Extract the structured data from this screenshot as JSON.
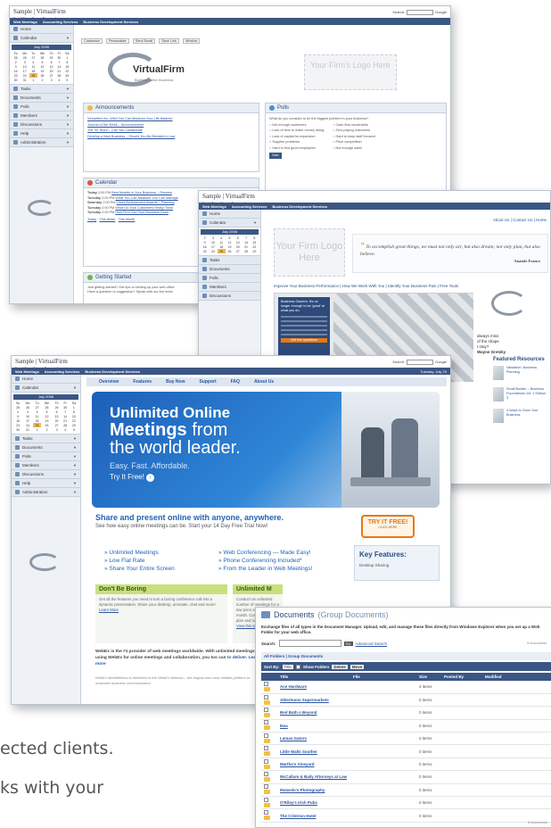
{
  "brand": {
    "title": "Sample | VirtualFirm",
    "subtitle": "Email Now | Forgot Password"
  },
  "search": {
    "label": "Search:",
    "engine": "Google"
  },
  "nav": {
    "items": [
      "Web Meetings",
      "Accounting Services",
      "Business Development Services"
    ]
  },
  "sidebar": {
    "items": [
      {
        "label": "Home",
        "icon": "home-icon"
      },
      {
        "label": "Calendar",
        "icon": "calendar-icon"
      },
      {
        "label": "Tasks",
        "icon": "tasks-icon"
      },
      {
        "label": "Documents",
        "icon": "documents-icon"
      },
      {
        "label": "Polls",
        "icon": "polls-icon"
      },
      {
        "label": "Members",
        "icon": "members-icon"
      },
      {
        "label": "Discussions",
        "icon": "discussions-icon"
      },
      {
        "label": "Help",
        "icon": "help-icon"
      },
      {
        "label": "Administration",
        "icon": "admin-icon"
      }
    ],
    "calendar": {
      "month": "July 2006",
      "days": [
        "Su",
        "Mo",
        "Tu",
        "We",
        "Th",
        "Fr",
        "Sa"
      ],
      "weeks": [
        [
          "25",
          "26",
          "27",
          "28",
          "29",
          "30",
          "1"
        ],
        [
          "2",
          "3",
          "4",
          "5",
          "6",
          "7",
          "8"
        ],
        [
          "9",
          "10",
          "11",
          "12",
          "13",
          "14",
          "15"
        ],
        [
          "16",
          "17",
          "18",
          "19",
          "20",
          "21",
          "22"
        ],
        [
          "23",
          "24",
          "25",
          "26",
          "27",
          "28",
          "29"
        ],
        [
          "30",
          "31",
          "1",
          "2",
          "3",
          "4",
          "5"
        ]
      ]
    }
  },
  "win1": {
    "toolbar": [
      "Customize",
      "Personalize",
      "Send Email",
      "Save Link",
      "Window"
    ],
    "logo_text": "VirtualFirm",
    "logo_tagline": "Building Better Business",
    "placeholder": "Your Firm's Logo Here",
    "announcements": {
      "title": "Announcements",
      "items": [
        "Virtualfirm Inc. Wish You Can Measure Your Life Balance",
        "Journal of the Week – Announcement",
        "The 'W' Word – Can You Collaborate",
        "Develop a New Business – Should You Be Blended in Law"
      ]
    },
    "polls": {
      "title": "Polls",
      "question": "What do you consider to be the biggest problem in your business?",
      "options_left": [
        "Not enough customers",
        "Lack of time to make money doing",
        "Lack of capital for expansion",
        "Supplier problems",
        "Hard to find good employees"
      ],
      "options_right": [
        "Cash flow constraints",
        "Zero paying customers",
        "Hard to keep staff focused",
        "Price competition",
        "Not enough sales"
      ],
      "vote": "Vote"
    },
    "calendar": {
      "title": "Calendar",
      "rows": [
        {
          "day": "Today",
          "time": "2:00 PM",
          "event": "Best Models in Your Business – Preview"
        },
        {
          "day": "Tuesday",
          "time": "2:00 PM",
          "event": "What You Can Measure You Can Manage"
        },
        {
          "day": "Saturday",
          "time": "2:00 PM",
          "event": "Client Achievement Awards – Planning"
        },
        {
          "day": "Tuesday",
          "time": "2:00 PM",
          "event": "What Do Your Customers Really Think"
        },
        {
          "day": "Tuesday",
          "time": "2:00 PM",
          "event": "How Firm Can Your Business Grow"
        }
      ],
      "footer": [
        "Today",
        "This Week",
        "This Month"
      ]
    },
    "getting_started": {
      "title": "Getting Started",
      "items": [
        "Just getting started? Get tips on setting up your web office",
        "Have a question or suggestion? Speak with our live team"
      ]
    }
  },
  "win2": {
    "top_links": "About Us | Contact Us | Home",
    "logo": "Your Firm Logo Here",
    "quote": "To accomplish great things, we must not only act, but also dream; not only plan, but also believe.",
    "quote_author": "Anatole France",
    "subnav": "Improve Your Business Performance | How We Work With You | Identify Your Business Pain | Free Tools",
    "body_title": "Business Owners: It's no longer enough to be 'good' at what you do.",
    "cta": "Get the questions",
    "side_snip": [
      "always miss",
      "of the shape",
      "t stay?",
      "Wayne Gretzky"
    ],
    "featured_title": "Featured Resources",
    "featured": [
      "Validation: Business Planning",
      "Small Builder – Business Foundations Vol. 1 Edition 3",
      "4 Ways to Grow Your Business"
    ],
    "more": "more"
  },
  "win3": {
    "tabs": [
      "Overview",
      "Features",
      "Buy Now",
      "Support",
      "FAQ",
      "About Us"
    ],
    "date": "Tuesday, July 25",
    "banner": {
      "line1": "Unlimited Online",
      "line2": "Meetings",
      "line2b": "from",
      "line3": "the world leader.",
      "line4": "Easy. Fast. Affordable.",
      "line5": "Try It Free!"
    },
    "headline": "Share and present online with anyone, anywhere.",
    "subhead": "See how easy online meetings can be. Start your 14 Day Free Trial Now!",
    "try_btn": "TRY IT FREE!",
    "try_sub": "CLICK HERE",
    "features_left": [
      "Unlimited Meetings",
      "Low Flat Rate",
      "Share Your Entire Screen"
    ],
    "features_right": [
      "Web Conferencing — Made Easy!",
      "Phone Conferencing Included*",
      "From the Leader in Web Meetings!"
    ],
    "key_title": "Key Features:",
    "key_item": "Desktop Sharing",
    "dont_title": "Don't Be Boring",
    "dont_body": "Get all the features you need to turn a boring conference call into a dynamic presentation. Share your desktop, annotate, chat and more!",
    "learn_more": "Learn More",
    "unl_title": "Unlimited M",
    "unl_body": "Conduct an unlimited number of meetings for a low price of just per month. Compare our plan and save money.",
    "view_pricing": "View this special offer",
    "webex": "WebEx is the #1 provider of web meetings worldwide. With unlimited meetings using WebEx for online meetings and collaboration, you too can",
    "webex_link": "to deliver. Learn more",
    "footer_note": "WebEx MeetMeNow is delivered to the WebEx Network – the largest and most reliable platform to maximize business communication."
  },
  "win4": {
    "title": "Documents",
    "title_sub": "(Group Documents)",
    "desc": "Exchange files of all types in the Document Manager. Upload, edit, and manage these files directly from Windows Explorer when you set up a Web Folder for your web office.",
    "search_label": "Search:",
    "go": "Go",
    "adv": "Advanced Search",
    "count": "8 documents",
    "crumb": "All Folders | Group Documents",
    "sort_label": "Sort By:",
    "sort_value": "Title",
    "show_folders": "Show Folders",
    "btn_delete": "Delete",
    "btn_move": "Move",
    "columns": [
      "Title",
      "File",
      "Size",
      "Posted By",
      "Modified"
    ],
    "rows": [
      {
        "title": "Ace Hardware",
        "size": "4 items"
      },
      {
        "title": "Albertsons Supermarkets",
        "size": "0 items"
      },
      {
        "title": "Bed Bath n Beyond",
        "size": "0 items"
      },
      {
        "title": "Ikea",
        "size": "0 items"
      },
      {
        "title": "Lamas Gators",
        "size": "0 items"
      },
      {
        "title": "Little Walls Souther",
        "size": "0 items"
      },
      {
        "title": "Martha's Vineyard",
        "size": "0 items"
      },
      {
        "title": "McCallum & Baily Attorneys at Law",
        "size": "0 items"
      },
      {
        "title": "Mutardo's Photography",
        "size": "0 items"
      },
      {
        "title": "O'Riley's Irish Pubs",
        "size": "0 items"
      },
      {
        "title": "The Criterion Hotel",
        "size": "0 items"
      }
    ],
    "footer": "8 documents"
  },
  "caption": {
    "line1": "ected clients.",
    "line2": "ks with your"
  },
  "colors": {
    "nav": "#3b5685",
    "accent": "#e27a17",
    "link": "#2c55a0"
  }
}
